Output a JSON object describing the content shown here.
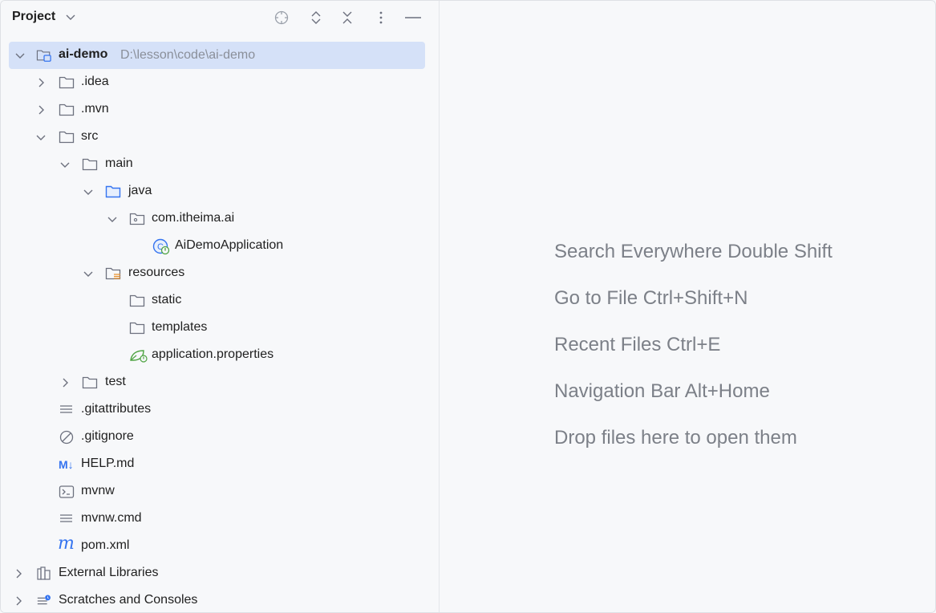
{
  "panel": {
    "title": "Project",
    "title_icon": "chevron-down-icon",
    "header_icons": [
      "locate-icon",
      "expand-all-icon",
      "collapse-all-icon",
      "more-options-icon",
      "hide-panel-icon"
    ]
  },
  "tree": [
    {
      "label": "ai-demo",
      "path": "D:\\lesson\\code\\ai-demo",
      "icon": "project-module-icon",
      "expanded": true,
      "selected": true
    },
    {
      "label": ".idea",
      "icon": "folder-icon",
      "expanded": false
    },
    {
      "label": ".mvn",
      "icon": "folder-icon",
      "expanded": false
    },
    {
      "label": "src",
      "icon": "folder-icon",
      "expanded": true
    },
    {
      "label": "main",
      "icon": "folder-icon",
      "expanded": true
    },
    {
      "label": "java",
      "icon": "source-folder-icon",
      "expanded": true
    },
    {
      "label": "com.itheima.ai",
      "icon": "package-icon",
      "expanded": true
    },
    {
      "label": "AiDemoApplication",
      "icon": "spring-boot-class-icon"
    },
    {
      "label": "resources",
      "icon": "resources-folder-icon",
      "expanded": true
    },
    {
      "label": "static",
      "icon": "folder-icon"
    },
    {
      "label": "templates",
      "icon": "folder-icon"
    },
    {
      "label": "application.properties",
      "icon": "spring-properties-icon"
    },
    {
      "label": "test",
      "icon": "folder-icon",
      "expanded": false
    },
    {
      "label": ".gitattributes",
      "icon": "text-file-icon"
    },
    {
      "label": ".gitignore",
      "icon": "ignore-file-icon"
    },
    {
      "label": "HELP.md",
      "icon": "markdown-icon",
      "icon_text": "M↓"
    },
    {
      "label": "mvnw",
      "icon": "shell-script-icon"
    },
    {
      "label": "mvnw.cmd",
      "icon": "text-file-icon"
    },
    {
      "label": "pom.xml",
      "icon": "maven-icon",
      "icon_text": "m"
    },
    {
      "label": "External Libraries",
      "icon": "libraries-icon",
      "expanded": false
    },
    {
      "label": "Scratches and Consoles",
      "icon": "scratches-icon",
      "expanded": false
    }
  ],
  "hints": [
    "Search Everywhere Double Shift",
    "Go to File Ctrl+Shift+N",
    "Recent Files Ctrl+E",
    "Navigation Bar Alt+Home",
    "Drop files here to open them"
  ],
  "colors": {
    "selection": "#d5e1f8",
    "accent_blue": "#3574f0",
    "spring_green": "#4ea342",
    "hint_text": "#7c8088"
  }
}
